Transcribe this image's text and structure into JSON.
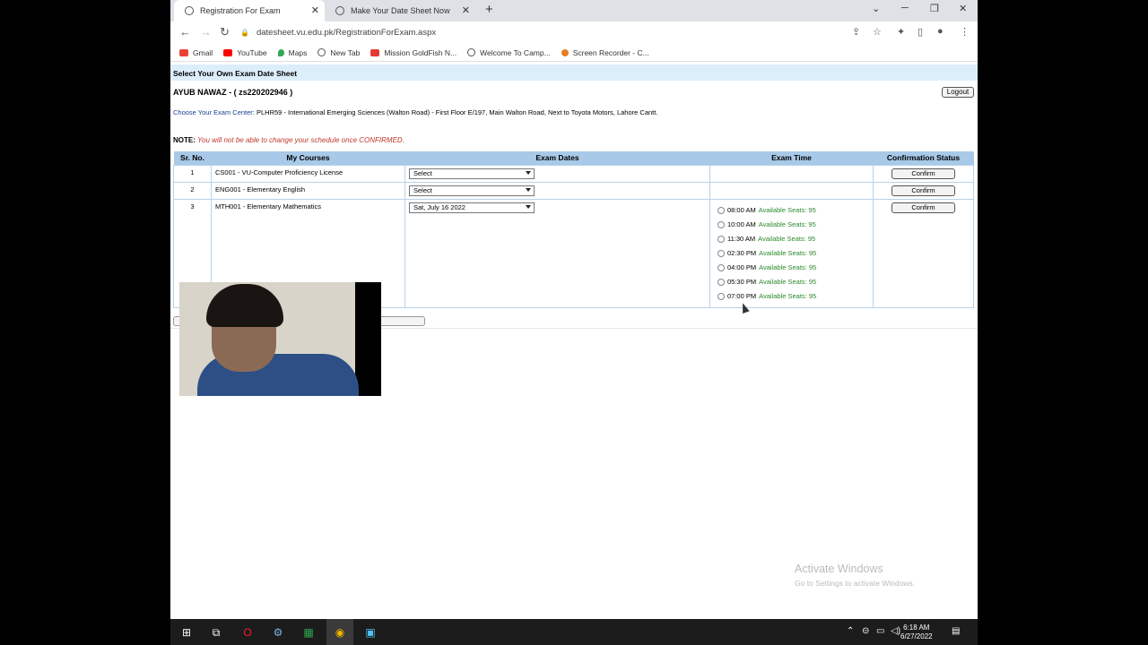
{
  "browser": {
    "tabs": [
      {
        "title": "Registration For Exam",
        "active": true
      },
      {
        "title": "Make Your Date Sheet Now",
        "active": false
      }
    ],
    "url": "datesheet.vu.edu.pk/RegistrationForExam.aspx",
    "bookmarks": [
      {
        "label": "Gmail",
        "color": "#ea4335"
      },
      {
        "label": "YouTube",
        "color": "#ff0000"
      },
      {
        "label": "Maps",
        "color": "#34a853"
      },
      {
        "label": "New Tab",
        "color": "#555555"
      },
      {
        "label": "Mission GoldFish N...",
        "color": "#e53935"
      },
      {
        "label": "Welcome To Camp...",
        "color": "#555555"
      },
      {
        "label": "Screen Recorder - C...",
        "color": "#e67e22"
      }
    ]
  },
  "page": {
    "header": "Select Your Own Exam Date Sheet",
    "student": "AYUB NAWAZ - ( zs220202946 )",
    "logout_label": "Logout",
    "center_label": "Choose Your Exam Center:",
    "center_value": "PLHR59 - International Emerging Sciences (Walton Road) - First Floor E/197, Main Walton Road, Next to Toyota Motors, Lahore Cantt.",
    "note_label": "NOTE:",
    "note_text": "You will not be able to change your schedule once CONFIRMED.",
    "columns": [
      "Sr. No.",
      "My Courses",
      "Exam Dates",
      "Exam Time",
      "Confirmation Status"
    ],
    "rows": [
      {
        "sr": "1",
        "course": "CS001 - VU-Computer Proficiency License",
        "date": "Select",
        "button": "Confirm"
      },
      {
        "sr": "2",
        "course": "ENG001 - Elementary English",
        "date": "Select",
        "button": "Confirm"
      },
      {
        "sr": "3",
        "course": "MTH001 - Elementary Mathematics",
        "date": "Sat, July 16 2022",
        "button": "Confirm"
      }
    ],
    "slots": [
      {
        "time": "08:00 AM",
        "seats": "Available Seats: 95"
      },
      {
        "time": "10:00 AM",
        "seats": "Available Seats: 95"
      },
      {
        "time": "11:30 AM",
        "seats": "Available Seats: 95"
      },
      {
        "time": "02:30 PM",
        "seats": "Available Seats: 95"
      },
      {
        "time": "04:00 PM",
        "seats": "Available Seats: 95"
      },
      {
        "time": "05:30 PM",
        "seats": "Available Seats: 95"
      },
      {
        "time": "07:00 PM",
        "seats": "Available Seats: 95"
      }
    ],
    "activate": {
      "title": "Activate Windows",
      "subtitle": "Go to Settings to activate Windows."
    }
  },
  "taskbar": {
    "time": "6:18 AM",
    "date": "6/27/2022"
  }
}
